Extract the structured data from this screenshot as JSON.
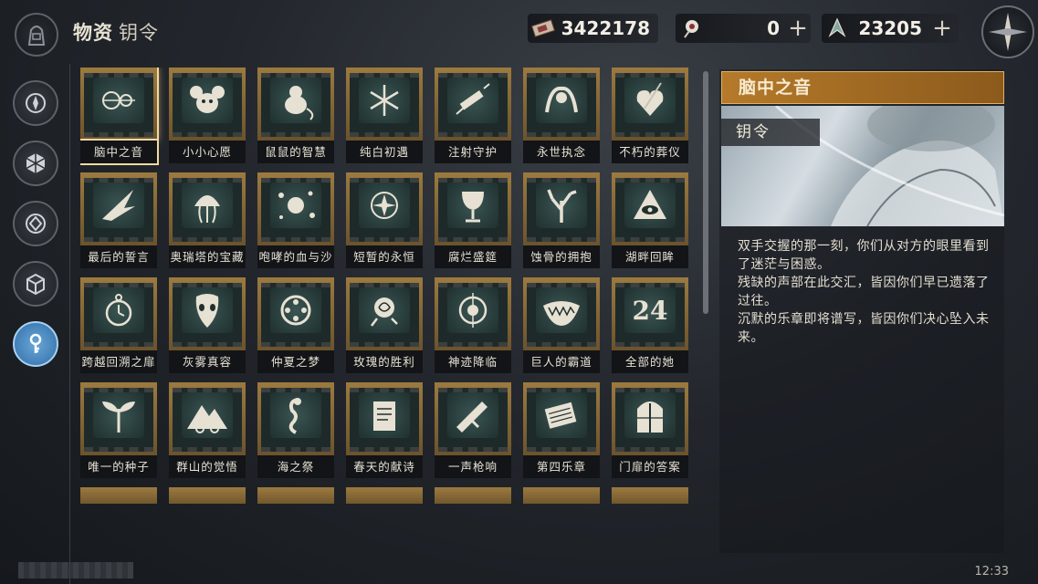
{
  "header": {
    "title": "物资",
    "subtitle": "钥令"
  },
  "currencies": [
    {
      "icon": "ticket-icon",
      "value": "3422178",
      "has_plus": false
    },
    {
      "icon": "orb-icon",
      "value": "0",
      "has_plus": true
    },
    {
      "icon": "shard-icon",
      "value": "23205",
      "has_plus": true
    }
  ],
  "sidebar": [
    {
      "icon": "compass-badge-icon",
      "active": false
    },
    {
      "icon": "cube-hex-icon",
      "active": false
    },
    {
      "icon": "diamond-badge-icon",
      "active": false
    },
    {
      "icon": "box-icon",
      "active": false
    },
    {
      "icon": "key-icon",
      "active": true
    }
  ],
  "items": [
    {
      "label": "脑中之音",
      "icon": "gear-chain-icon",
      "selected": true
    },
    {
      "label": "小小心愿",
      "icon": "mouse-icon"
    },
    {
      "label": "鼠鼠的智慧",
      "icon": "rat-icon"
    },
    {
      "label": "纯白初遇",
      "icon": "snowflake-icon"
    },
    {
      "label": "注射守护",
      "icon": "syringe-icon"
    },
    {
      "label": "永世执念",
      "icon": "snake-icon"
    },
    {
      "label": "不朽的葬仪",
      "icon": "heart-dagger-icon"
    },
    {
      "label": "最后的誓言",
      "icon": "wing-icon"
    },
    {
      "label": "奥瑞塔的宝藏",
      "icon": "jellyfish-icon"
    },
    {
      "label": "咆哮的血与沙",
      "icon": "splash-icon"
    },
    {
      "label": "短暂的永恒",
      "icon": "star-circle-icon"
    },
    {
      "label": "腐烂盛筵",
      "icon": "goblet-icon"
    },
    {
      "label": "蚀骨的拥抱",
      "icon": "coral-icon"
    },
    {
      "label": "湖畔回眸",
      "icon": "eye-triangle-icon"
    },
    {
      "label": "跨越回溯之扉",
      "icon": "pocket-watch-icon"
    },
    {
      "label": "灰雾真容",
      "icon": "mask-icon"
    },
    {
      "label": "仲夏之梦",
      "icon": "film-reel-icon"
    },
    {
      "label": "玫瑰的胜利",
      "icon": "rose-icon"
    },
    {
      "label": "神迹降临",
      "icon": "halo-icon"
    },
    {
      "label": "巨人的霸道",
      "icon": "jaw-icon"
    },
    {
      "label": "全部的她",
      "icon": "number-24-icon",
      "text": "24"
    },
    {
      "label": "唯一的种子",
      "icon": "sprout-icon"
    },
    {
      "label": "群山的觉悟",
      "icon": "mountain-icon"
    },
    {
      "label": "海之祭",
      "icon": "seahorse-icon"
    },
    {
      "label": "春天的献诗",
      "icon": "scroll-icon"
    },
    {
      "label": "一声枪响",
      "icon": "gun-icon"
    },
    {
      "label": "第四乐章",
      "icon": "sheet-music-icon"
    },
    {
      "label": "门扉的答案",
      "icon": "door-icon"
    }
  ],
  "detail": {
    "title": "脑中之音",
    "type": "钥令",
    "description": "双手交握的那一刻，你们从对方的眼里看到了迷茫与困惑。\n残缺的声部在此交汇，皆因你们早已遗落了过往。\n沉默的乐章即将谱写，皆因你们决心坠入未来。"
  },
  "status": {
    "time": "12:33"
  }
}
